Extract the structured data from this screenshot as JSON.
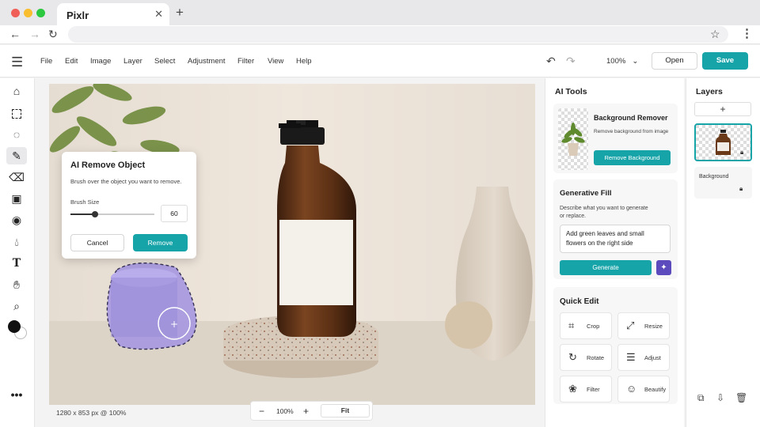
{
  "browser": {
    "tab_title": "Pixlr",
    "tab_close": "✕",
    "new_tab": "+"
  },
  "menu": {
    "items": [
      "File",
      "Edit",
      "Image",
      "Layer",
      "Select",
      "Adjustment",
      "Filter",
      "View",
      "Help"
    ],
    "zoom": "100%",
    "open_label": "Open",
    "save_label": "Save"
  },
  "dialog": {
    "title": "AI Remove Object",
    "description": "Brush over the object you want to remove.",
    "brush_label": "Brush Size",
    "brush_value": "60",
    "brush_fraction": 0.29,
    "cancel_label": "Cancel",
    "remove_label": "Remove"
  },
  "canvas": {
    "status": "1280 x 853 px @ 100%",
    "zoom_minus": "−",
    "zoom_value": "100%",
    "zoom_plus": "+",
    "fit_label": "Fit"
  },
  "ai_tools": {
    "heading": "AI Tools",
    "bg_remover": {
      "title": "Background Remover",
      "desc": "Remove background from image",
      "button": "Remove Background"
    },
    "gen_fill": {
      "title": "Generative Fill",
      "desc_line1": "Describe what you want to generate",
      "desc_line2": "or replace.",
      "prompt_line1": "Add green leaves and small",
      "prompt_line2": "flowers on the right side",
      "button": "Generate"
    },
    "quick_edit": {
      "title": "Quick Edit",
      "items": [
        "Crop",
        "Resize",
        "Rotate",
        "Adjust",
        "Filter",
        "Beautify"
      ]
    }
  },
  "layers": {
    "heading": "Layers",
    "add": "+",
    "background_label": "Background"
  },
  "colors": {
    "accent": "#17a4a9",
    "ai_purple": "#5b4bbd",
    "selection": "#a99be0"
  }
}
